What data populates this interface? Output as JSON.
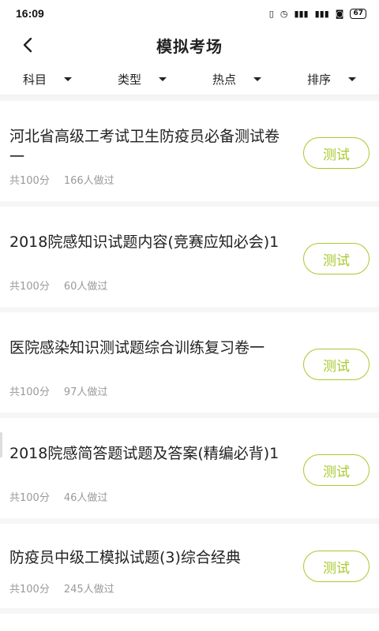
{
  "status": {
    "time": "16:09",
    "battery": "67"
  },
  "nav": {
    "title": "模拟考场"
  },
  "filters": [
    "科目",
    "类型",
    "热点",
    "排序"
  ],
  "items": [
    {
      "title": "河北省高级工考试卫生防疫员必备测试卷一",
      "score": "共100分",
      "count": "166人做过",
      "button": "测试"
    },
    {
      "title": "2018院感知识试题内容(竞赛应知必会)1",
      "score": "共100分",
      "count": "60人做过",
      "button": "测试"
    },
    {
      "title": "医院感染知识测试题综合训练复习卷一",
      "score": "共100分",
      "count": "97人做过",
      "button": "测试"
    },
    {
      "title": "2018院感简答题试题及答案(精编必背)1",
      "score": "共100分",
      "count": "46人做过",
      "button": "测试"
    },
    {
      "title": "防疫员中级工模拟试题(3)综合经典",
      "score": "共100分",
      "count": "245人做过",
      "button": "测试"
    }
  ],
  "colors": {
    "accent": "#a7c92c"
  },
  "icons": [
    "back-arrow-icon",
    "caret-down-icon",
    "vibrate-icon",
    "alarm-icon",
    "signal-icon",
    "wifi-icon",
    "battery-icon"
  ]
}
